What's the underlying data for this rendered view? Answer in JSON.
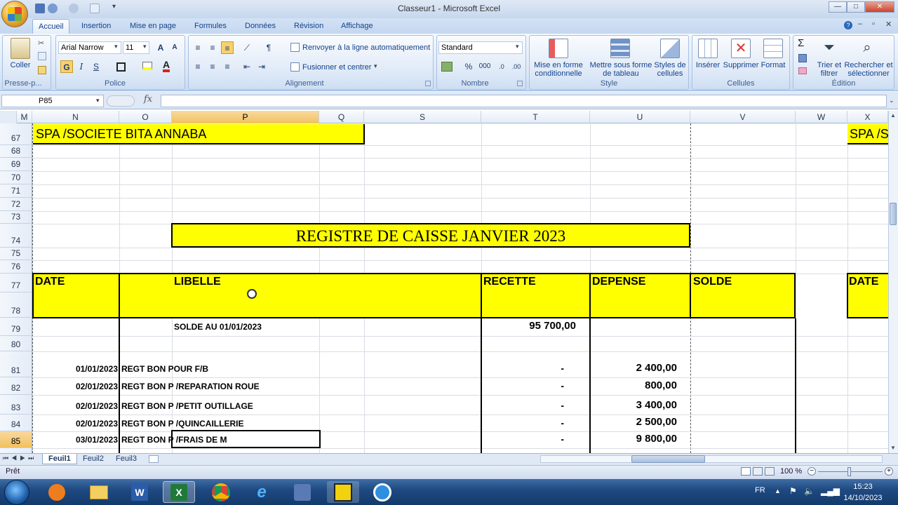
{
  "window": {
    "title": "Classeur1 - Microsoft Excel",
    "btn_min": "—",
    "btn_max": "□",
    "btn_close": "✕"
  },
  "tabs": [
    "Accueil",
    "Insertion",
    "Mise en page",
    "Formules",
    "Données",
    "Révision",
    "Affichage"
  ],
  "ribbon": {
    "paste_label": "Coller",
    "clipboard_group": "Presse-p...",
    "font_name": "Arial Narrow",
    "font_size": "11",
    "bold": "G",
    "italic": "I",
    "underline": "S",
    "font_group": "Police",
    "wrap_text": "Renvoyer à la ligne automatiquement",
    "merge_center": "Fusionner et centrer",
    "alignment_group": "Alignement",
    "number_format": "Standard",
    "percent": "%",
    "thousands": "000",
    "number_group": "Nombre",
    "cond_format_1": "Mise en forme",
    "cond_format_2": "conditionnelle",
    "table_format_1": "Mettre sous forme",
    "table_format_2": "de tableau",
    "cell_styles_1": "Styles de",
    "cell_styles_2": "cellules",
    "style_group": "Style",
    "insert": "Insérer",
    "delete": "Supprimer",
    "format": "Format",
    "cells_group": "Cellules",
    "sort_1": "Trier et",
    "sort_2": "filtrer",
    "find_1": "Rechercher et",
    "find_2": "sélectionner",
    "editing_group": "Édition"
  },
  "formula_bar": {
    "name_box": "P85",
    "fx": "fx",
    "value": ""
  },
  "columns": [
    "M",
    "N",
    "O",
    "P",
    "Q",
    "S",
    "T",
    "U",
    "V",
    "W",
    "X"
  ],
  "rows": [
    "67",
    "68",
    "69",
    "70",
    "71",
    "72",
    "73",
    "74",
    "75",
    "76",
    "77",
    "78",
    "79",
    "80",
    "81",
    "82",
    "83",
    "84",
    "85"
  ],
  "sheet": {
    "company": "SPA /SOCIETE  BITA  ANNABA",
    "company_right": "SPA /S",
    "register_title": "REGISTRE DE  CAISSE   JANVIER 2023",
    "headers": {
      "date": "DATE",
      "libelle": "LIBELLE",
      "recette": "RECETTE",
      "depense": "DEPENSE",
      "solde": "SOLDE",
      "date_right": "DATE"
    },
    "opening_label": "SOLDE  AU 01/01/2023",
    "opening_recette": "95 700,00",
    "entries": [
      {
        "date": "01/01/2023",
        "libelle": "REGT BON POUR F/B",
        "recette": "-",
        "depense": "2 400,00"
      },
      {
        "date": "02/01/2023",
        "libelle": "REGT BON P /REPARATION ROUE",
        "recette": "-",
        "depense": "800,00"
      },
      {
        "date": "02/01/2023",
        "libelle": "REGT BON P /PETIT OUTILLAGE",
        "recette": "-",
        "depense": "3 400,00"
      },
      {
        "date": "02/01/2023",
        "libelle": "REGT BON P /QUINCAILLERIE",
        "recette": "-",
        "depense": "2 500,00"
      },
      {
        "date": "03/01/2023",
        "libelle": "REGT BON P /FRAIS DE M",
        "recette": "-",
        "depense": "9 800,00"
      }
    ]
  },
  "sheet_tabs": [
    "Feuil1",
    "Feuil2",
    "Feuil3"
  ],
  "status": {
    "ready": "Prêt",
    "zoom": "100 %"
  },
  "taskbar": {
    "lang": "FR",
    "time": "15:23",
    "date": "14/10/2023"
  }
}
